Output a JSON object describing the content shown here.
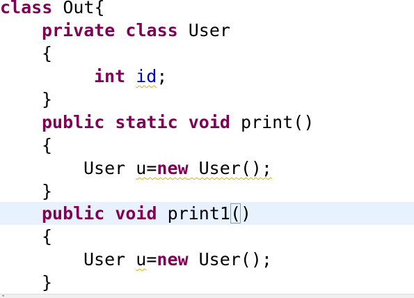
{
  "code": {
    "l1": {
      "kw1": "class",
      "rest": " Out{"
    },
    "l2": {
      "kw1": "private",
      "kw2": "class",
      "rest": " User"
    },
    "l3": {
      "text": "{"
    },
    "l4": {
      "kw1": "int",
      "field": "id",
      "rest": ";"
    },
    "l5": {
      "text": "}"
    },
    "l6": {
      "kw1": "public",
      "kw2": "static",
      "kw3": "void",
      "rest": " print()"
    },
    "l7": {
      "text": "{"
    },
    "l8": {
      "p1": "User ",
      "p2": "u",
      "p3": "=",
      "kw1": "new",
      "p4": "User();",
      "p5": ""
    },
    "l9": {
      "text": "}"
    },
    "l10": {
      "kw1": "public",
      "kw2": "void",
      "name": " print1",
      "paren_open": "(",
      "paren_close": ")"
    },
    "l11": {
      "text": "{"
    },
    "l12": {
      "p1": "User ",
      "p2": "u",
      "p3": "=",
      "kw1": "new",
      "p4": " User();"
    },
    "l13": {
      "text": "}"
    }
  },
  "scrollbar": {
    "left_arrow": "◂"
  },
  "colors": {
    "keyword": "#7f0055",
    "field": "#0000c0",
    "current_line": "#e8f2fe",
    "warning_underline": "#d7b400"
  }
}
